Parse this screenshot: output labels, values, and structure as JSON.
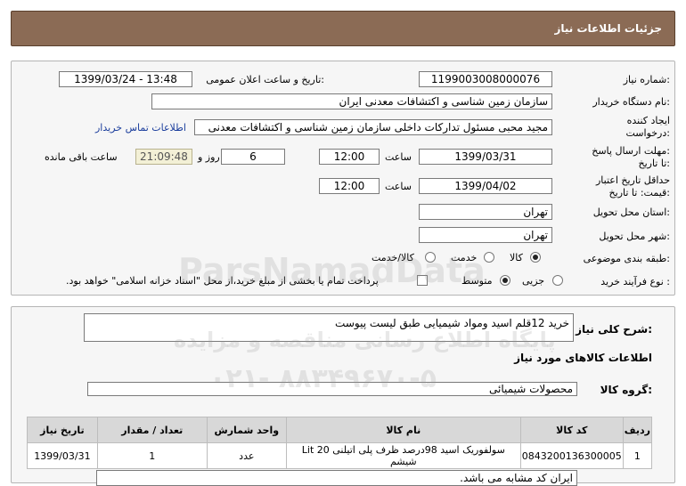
{
  "header": {
    "title": "جزئیات اطلاعات نیاز"
  },
  "form": {
    "need_number_label": "شماره نیاز:",
    "need_number": "1199003008000076",
    "announce_label": "تاریخ و ساعت اعلان عمومی:",
    "announce_value": "1399/03/24 - 13:48",
    "buyer_label": "نام دستگاه خریدار:",
    "buyer_value": "سازمان زمین شناسی و اکتشافات معدنی ایران",
    "creator_label_1": "ایجاد کننده",
    "creator_label_2": "درخواست:",
    "creator_value": "مجید محبی مسئول تدارکات داخلی سازمان زمین شناسی و اکتشافات معدنی",
    "contact_link": "اطلاعات تماس خریدار",
    "deadline_label_1": "مهلت ارسال پاسخ:",
    "deadline_label_2": "تا تاریخ:",
    "deadline_date": "1399/03/31",
    "time_label": "ساعت",
    "deadline_time": "12:00",
    "days_value": "6",
    "days_label": "روز و",
    "remaining_time": "21:09:48",
    "remaining_label": "ساعت باقی مانده",
    "validity_label_1": "حداقل تاریخ اعتبار",
    "validity_label_2": "قیمت: تا تاریخ:",
    "validity_date": "1399/04/02",
    "validity_time": "12:00",
    "province_label": "استان محل تحویل:",
    "province_value": "تهران",
    "city_label": "شهر محل تحویل:",
    "city_value": "تهران",
    "category_label": "طبقه بندی موضوعی:",
    "category_options": [
      "کالا",
      "خدمت",
      "کالا/خدمت"
    ],
    "category_selected": "کالا",
    "process_label": "نوع فرآیند خرید :",
    "process_options": [
      "جزیی",
      "متوسط"
    ],
    "process_selected": "متوسط",
    "payment_note": "پرداخت تمام یا بخشی از مبلغ خرید،از محل \"اسناد خزانه اسلامی\" خواهد بود."
  },
  "description": {
    "label": "شرح کلی نیاز:",
    "value": "خرید 12قلم اسید ومواد شیمیایی طبق لیست پیوست"
  },
  "goods": {
    "section_title": "اطلاعات کالاهای مورد نیاز",
    "group_label": "گروه کالا:",
    "group_value": "محصولات شیمیائی",
    "columns": [
      "ردیف",
      "کد کالا",
      "نام کالا",
      "واحد شمارش",
      "تعداد / مقدار",
      "تاریخ نیاز"
    ],
    "rows": [
      [
        "1",
        "0843200136300005",
        "سولفوریک اسید 98درصد ظرف پلی اتیلنی 20 Lit شیشم",
        "عدد",
        "1",
        "1399/03/31"
      ]
    ],
    "note": "ایران کد مشابه می باشد."
  },
  "watermark": {
    "line1": "ParsNamadData",
    "line2": "پایگاه اطلاع رسانی مناقصه و مزایده",
    "line3": "۰۲۱- ۸۸۳۴۹۶۷۰-۵"
  }
}
